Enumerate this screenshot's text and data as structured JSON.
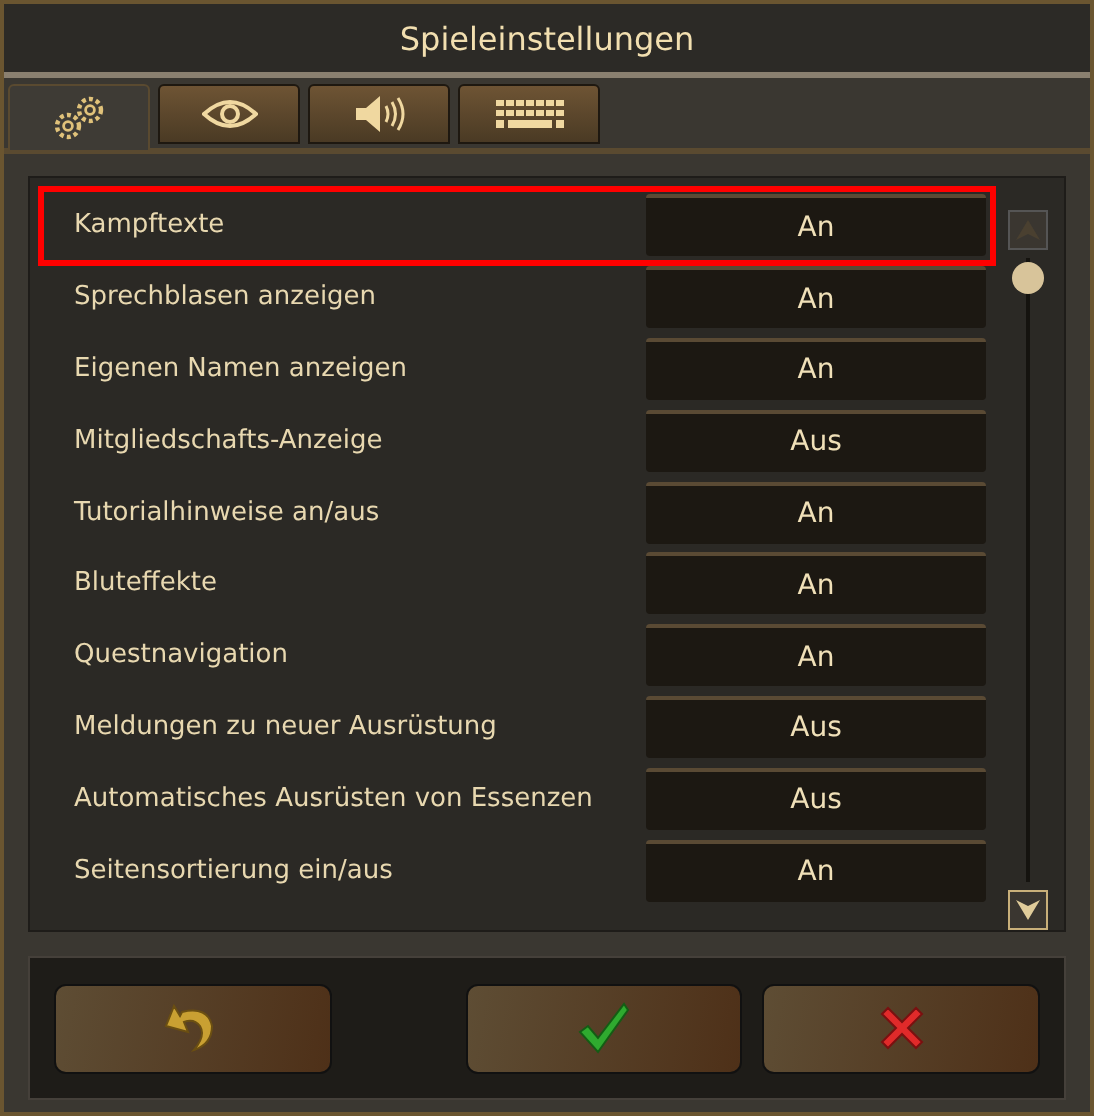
{
  "window": {
    "title": "Spieleinstellungen"
  },
  "tabs": [
    {
      "kind": "gears",
      "selected": true
    },
    {
      "kind": "eye",
      "selected": false
    },
    {
      "kind": "speaker",
      "selected": false
    },
    {
      "kind": "keyboard",
      "selected": false
    }
  ],
  "settings": [
    {
      "label": "Kampftexte",
      "value": "An",
      "highlighted": true
    },
    {
      "label": "Sprechblasen anzeigen",
      "value": "An",
      "highlighted": false
    },
    {
      "label": "Eigenen Namen anzeigen",
      "value": "An",
      "highlighted": false
    },
    {
      "label": "Mitgliedschafts-Anzeige",
      "value": "Aus",
      "highlighted": false
    },
    {
      "label": "Tutorialhinweise an/aus",
      "value": "An",
      "highlighted": false
    },
    {
      "label": "Bluteffekte",
      "value": "An",
      "highlighted": false
    },
    {
      "label": "Questnavigation",
      "value": "An",
      "highlighted": false
    },
    {
      "label": "Meldungen zu neuer Ausrüstung",
      "value": "Aus",
      "highlighted": false
    },
    {
      "label": "Automatisches Ausrüsten von Essenzen",
      "value": "Aus",
      "highlighted": false
    },
    {
      "label": "Seitensortierung ein/aus",
      "value": "An",
      "highlighted": false
    }
  ],
  "buttons": [
    {
      "kind": "reset"
    },
    {
      "kind": "confirm"
    },
    {
      "kind": "cancel"
    }
  ]
}
